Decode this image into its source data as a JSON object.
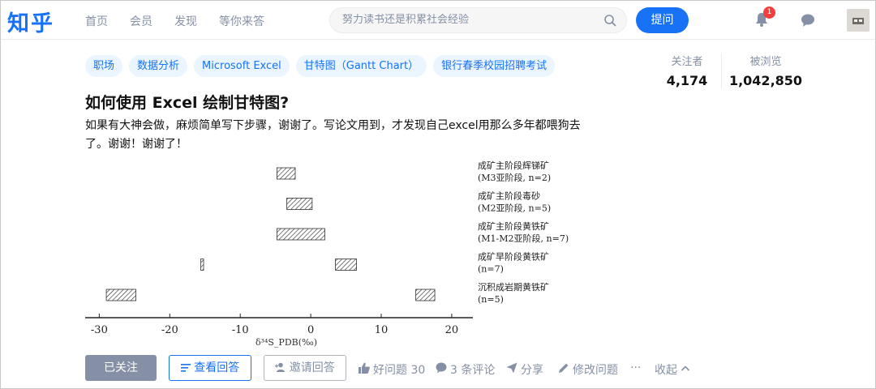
{
  "header": {
    "logo": "知乎",
    "nav": [
      "首页",
      "会员",
      "发现",
      "等你来答"
    ],
    "search_placeholder": "努力读书还是积累社会经验",
    "ask_label": "提问",
    "notification_count": "1"
  },
  "question": {
    "tags": [
      "职场",
      "数据分析",
      "Microsoft Excel",
      "甘特图（Gantt Chart）",
      "银行春季校园招聘考试"
    ],
    "title": "如何使用 Excel 绘制甘特图?",
    "description": "如果有大神会做，麻烦简单写下步骤，谢谢了。写论文用到，才发现自己excel用那么多年都喂狗去了。谢谢！谢谢了！",
    "stats": {
      "followers_label": "关注者",
      "followers": "4,174",
      "views_label": "被浏览",
      "views": "1,042,850"
    }
  },
  "actions": {
    "followed": "已关注",
    "view_answers": "查看回答",
    "invite": "邀请回答",
    "good_question": "好问题 30",
    "comments": "3 条评论",
    "share": "分享",
    "edit": "修改问题",
    "more": "···",
    "collapse": "收起"
  },
  "chart_data": {
    "type": "bar",
    "title": "",
    "xlabel": "δ³⁴S_PDB(‰)",
    "ylabel": "",
    "xlim": [
      -32,
      23
    ],
    "xticks": [
      -30,
      -20,
      -10,
      0,
      10,
      20
    ],
    "categories": [
      [
        "成矿主阶段辉锑矿",
        "(M3亚阶段, n=2)"
      ],
      [
        "成矿主阶段毒砂",
        "(M2亚阶段, n=5)"
      ],
      [
        "成矿主阶段黄铁矿",
        "(M1-M2亚阶段, n=7)"
      ],
      [
        "成矿早阶段黄铁矿",
        "(n=7)"
      ],
      [
        "沉积成岩期黄铁矿",
        "(n=5)"
      ]
    ],
    "ranges": [
      [
        [
          -4.8,
          -2.2
        ]
      ],
      [
        [
          -3.4,
          0.2
        ]
      ],
      [
        [
          -4.8,
          2.0
        ]
      ],
      [
        [
          -15.6,
          -15.2
        ],
        [
          3.5,
          6.5
        ]
      ],
      [
        [
          -29.0,
          -24.8
        ],
        [
          14.9,
          17.6
        ]
      ]
    ]
  }
}
